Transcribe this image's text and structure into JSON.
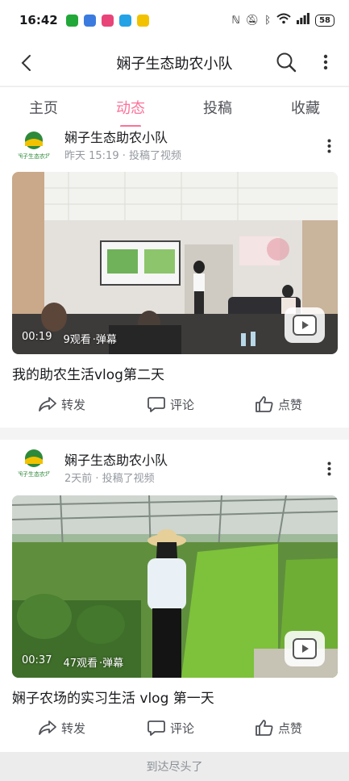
{
  "status_bar": {
    "time": "16:42",
    "battery": "58",
    "colors": {
      "app1": "#21a838",
      "app2": "#3b7be0",
      "app3": "#e8447a",
      "app4": "#23a2e6",
      "app5": "#f2c200"
    }
  },
  "header": {
    "title": "娴子生态助农小队",
    "back_icon": "chevron-left-icon",
    "search_icon": "search-icon",
    "more_icon": "more-vertical-icon"
  },
  "tabs": [
    {
      "label": "主页",
      "active": false
    },
    {
      "label": "动态",
      "active": true
    },
    {
      "label": "投稿",
      "active": false
    },
    {
      "label": "收藏",
      "active": false
    }
  ],
  "accent_color": "#fb7299",
  "posts": [
    {
      "author": "娴子生态助农小队",
      "avatar_text": "娴子生态农场",
      "meta": "昨天 15:19 · 投稿了视频",
      "duration": "00:19",
      "views": "9观看",
      "danmaku": "·弹幕",
      "title": "我的助农生活vlog第二天",
      "actions": {
        "share": "转发",
        "comment": "评论",
        "like": "点赞"
      }
    },
    {
      "author": "娴子生态助农小队",
      "avatar_text": "娴子生态农场",
      "meta": "2天前 · 投稿了视频",
      "duration": "00:37",
      "views": "47观看",
      "danmaku": "·弹幕",
      "title": "娴子农场的实习生活  vlog 第一天",
      "actions": {
        "share": "转发",
        "comment": "评论",
        "like": "点赞"
      }
    }
  ],
  "footer": {
    "end_text": "到达尽头了"
  }
}
